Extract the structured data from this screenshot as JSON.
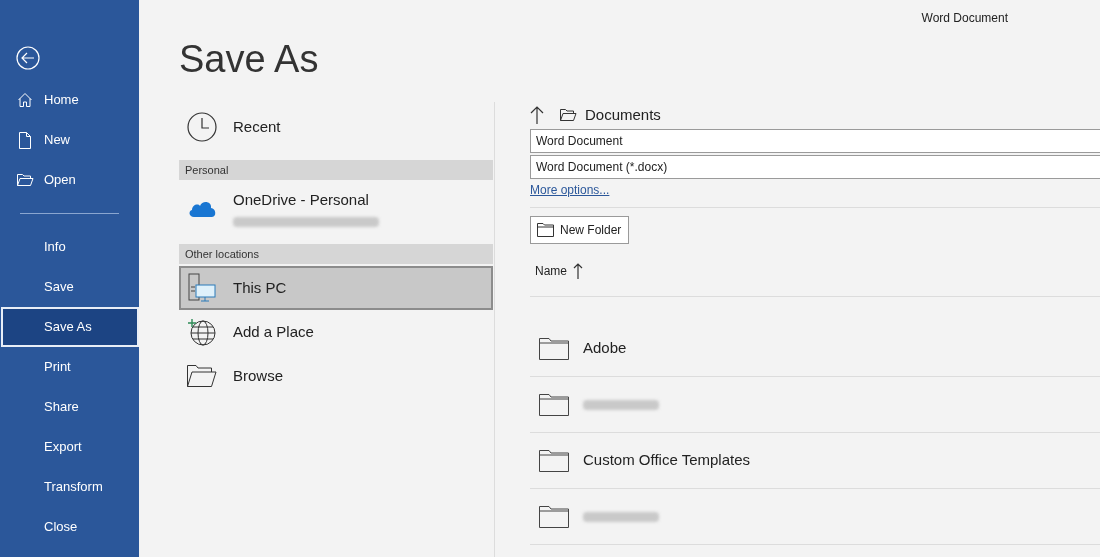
{
  "window": {
    "title": "Word Document"
  },
  "nav_top": [
    {
      "label": "Home",
      "selected": false
    },
    {
      "label": "New",
      "selected": false
    },
    {
      "label": "Open",
      "selected": false
    }
  ],
  "nav_bottom": [
    {
      "label": "Info",
      "selected": false
    },
    {
      "label": "Save",
      "selected": false
    },
    {
      "label": "Save As",
      "selected": true
    },
    {
      "label": "Print",
      "selected": false
    },
    {
      "label": "Share",
      "selected": false
    },
    {
      "label": "Export",
      "selected": false
    },
    {
      "label": "Transform",
      "selected": false
    },
    {
      "label": "Close",
      "selected": false
    }
  ],
  "page_title": "Save As",
  "locations": [
    {
      "kind": "place",
      "label": "Recent",
      "selected": false
    },
    {
      "kind": "heading",
      "label": "Personal"
    },
    {
      "kind": "account",
      "label": "OneDrive - Personal",
      "selected": false
    },
    {
      "kind": "heading",
      "label": "Other locations"
    },
    {
      "kind": "place",
      "label": "This PC",
      "selected": true
    },
    {
      "kind": "place",
      "label": "Add a Place",
      "selected": false
    },
    {
      "kind": "place",
      "label": "Browse",
      "selected": false
    }
  ],
  "path": "Documents",
  "file_name": {
    "value": "Word Document"
  },
  "file_type": {
    "value": "Word Document (*.docx)"
  },
  "more_options": "More options...",
  "new_folder": "New Folder",
  "column": "Name",
  "folders": [
    {
      "kind": "named",
      "label": "Adobe"
    },
    {
      "kind": "redacted"
    },
    {
      "kind": "named",
      "label": "Custom Office Templates"
    },
    {
      "kind": "redacted"
    }
  ]
}
